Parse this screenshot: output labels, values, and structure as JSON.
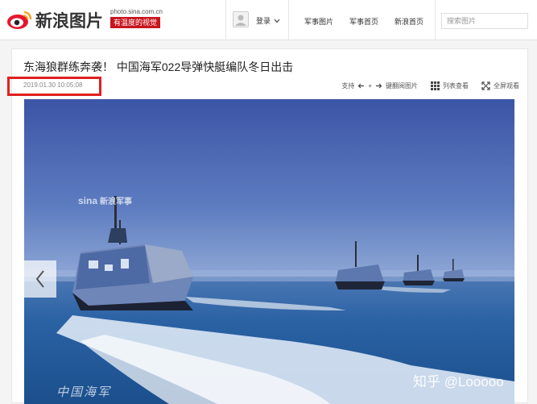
{
  "header": {
    "logo_text": "新浪图片",
    "site_url": "photo.sina.com.cn",
    "slogan": "有温度的视觉",
    "login_label": "登录",
    "nav": [
      "军事图片",
      "军事首页",
      "新浪首页"
    ],
    "search_placeholder": "搜索图片"
  },
  "article": {
    "title": "东海狼群练奔袭！ 中国海军022导弹快艇编队冬日出击",
    "timestamp": "2019.01.30 10:05:08",
    "support_label": "支持",
    "keyboard_label": "键翻阅图片",
    "list_view_label": "列表查看",
    "fullscreen_label": "全屏观看"
  },
  "photo": {
    "watermark_brand": "sina",
    "watermark_channel": "新浪军事",
    "signature": "中国海军",
    "zhihu_watermark": "知乎 @Looooo"
  },
  "colors": {
    "brand_red": "#c9151e",
    "highlight_red": "#e02020",
    "sky_top": "#3f5aa8",
    "sea": "#1f5fa0"
  },
  "icons": [
    "sina-eye-icon",
    "avatar-icon",
    "chevron-down-icon",
    "search-icon",
    "arrow-left-icon",
    "arrow-right-icon",
    "grid-icon",
    "fullscreen-icon",
    "chevron-left-icon"
  ]
}
